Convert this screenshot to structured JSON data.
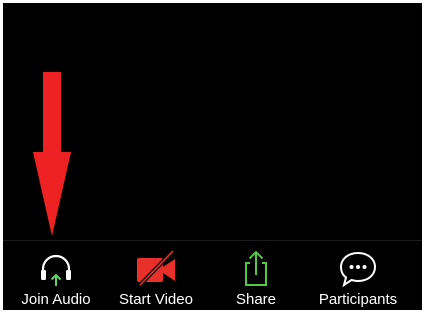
{
  "toolbar": {
    "items": [
      {
        "label": "Join Audio",
        "icon": "headphones-icon",
        "icon_color": "#ffffff",
        "accent": "#5fd35f"
      },
      {
        "label": "Start Video",
        "icon": "video-off-icon",
        "icon_color": "#e8302a"
      },
      {
        "label": "Share",
        "icon": "share-icon",
        "icon_color": "#4fc93f"
      },
      {
        "label": "Participants",
        "icon": "chat-bubble-icon",
        "icon_color": "#ffffff"
      }
    ]
  },
  "annotation": {
    "arrow_color": "#ee2222",
    "points_to": "Join Audio"
  },
  "colors": {
    "background": "#000000",
    "text": "#ffffff"
  }
}
